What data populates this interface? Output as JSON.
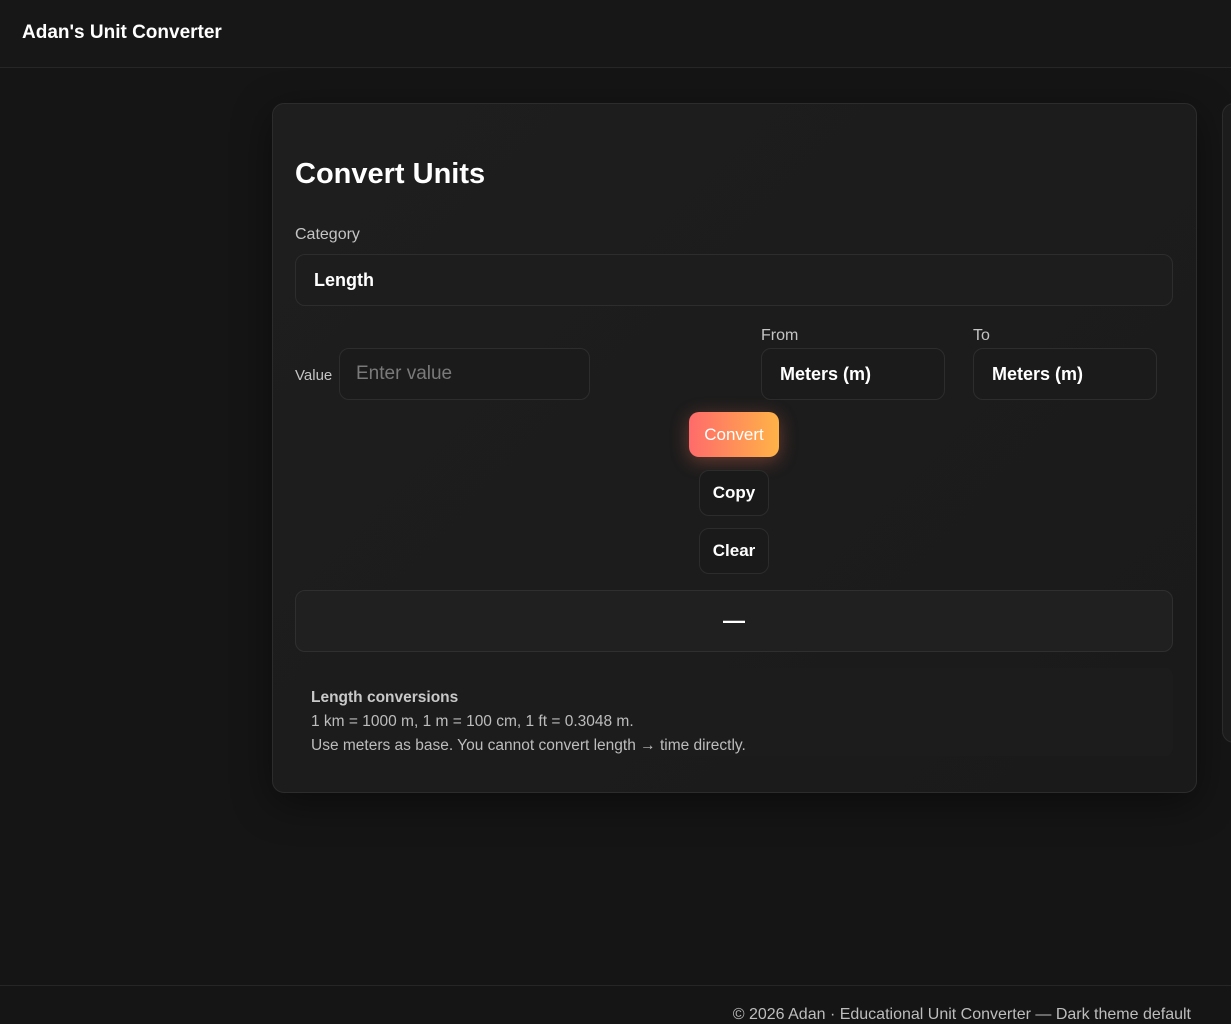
{
  "header": {
    "brand": "Adan's Unit Converter"
  },
  "converter": {
    "title": "Convert Units",
    "category_label": "Category",
    "category_value": "Length",
    "value_label": "Value",
    "value_placeholder": "Enter value",
    "value_current": "",
    "from_label": "From",
    "from_value": "Meters (m)",
    "to_label": "To",
    "to_value": "Meters (m)",
    "convert_label": "Convert",
    "copy_label": "Copy",
    "clear_label": "Clear",
    "result": "—",
    "info_title": "Length conversions",
    "info_line1": "1 km = 1000 m, 1 m = 100 cm, 1 ft = 0.3048 m.",
    "info_line2": "Use meters as base. You cannot convert length → time directly."
  },
  "footer": {
    "text": "© 2026 Adan · Educational Unit Converter — Dark theme default"
  },
  "colors": {
    "background": "#151515",
    "card": "#1e1e1e",
    "accent_start": "#ff6b6b",
    "accent_end": "#ffb347"
  }
}
